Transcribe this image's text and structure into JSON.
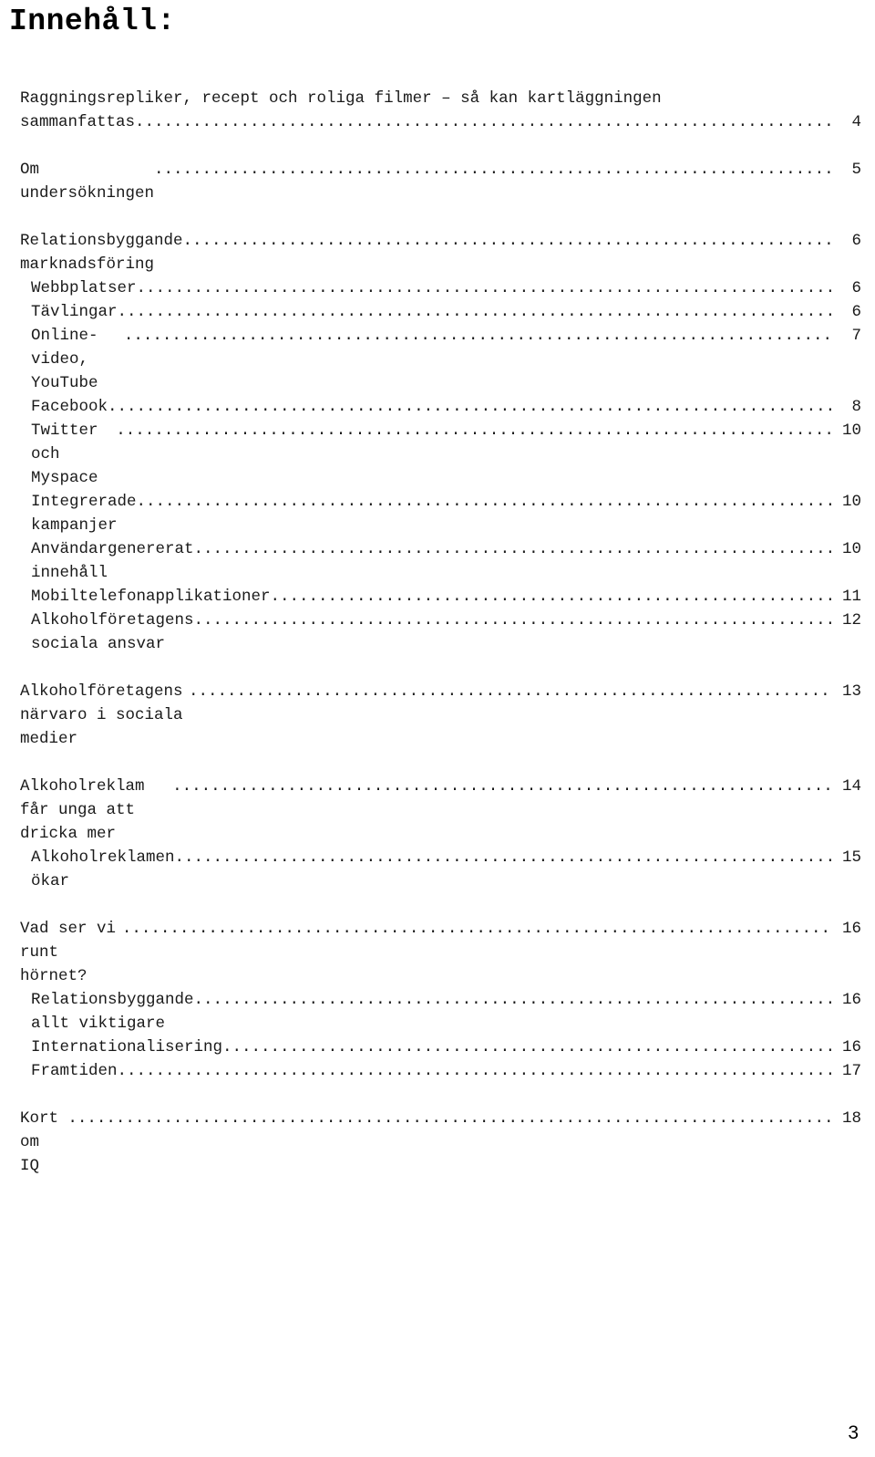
{
  "document": {
    "title": "Innehåll:",
    "footer_page_number": "3",
    "leader_char": "."
  },
  "toc": {
    "entries": [
      {
        "label": "Raggningsrepliker, recept och roliga filmer – så kan kartläggningen sammanfattas",
        "first_line": "Raggningsrepliker, recept och roliga filmer – så kan kartläggningen",
        "last_line": "sammanfattas",
        "page": "4",
        "level": 1,
        "wrapped": true,
        "gap_before": false
      },
      {
        "label": "Om undersökningen",
        "page": "5",
        "level": 1,
        "wrapped": false,
        "gap_before": true
      },
      {
        "label": "Relationsbyggande marknadsföring",
        "page": "6",
        "level": 1,
        "wrapped": false,
        "gap_before": true
      },
      {
        "label": "Webbplatser",
        "page": "6",
        "level": 2,
        "wrapped": false,
        "gap_before": false
      },
      {
        "label": "Tävlingar",
        "page": "6",
        "level": 2,
        "wrapped": false,
        "gap_before": false
      },
      {
        "label": "Online-video, YouTube",
        "page": "7",
        "level": 2,
        "wrapped": false,
        "gap_before": false
      },
      {
        "label": "Facebook",
        "page": "8",
        "level": 2,
        "wrapped": false,
        "gap_before": false
      },
      {
        "label": "Twitter och Myspace",
        "page": "10",
        "level": 2,
        "wrapped": false,
        "gap_before": false
      },
      {
        "label": "Integrerade kampanjer",
        "page": "10",
        "level": 2,
        "wrapped": false,
        "gap_before": false
      },
      {
        "label": "Användargenererat innehåll",
        "page": "10",
        "level": 2,
        "wrapped": false,
        "gap_before": false
      },
      {
        "label": "Mobiltelefonapplikationer",
        "page": "11",
        "level": 2,
        "wrapped": false,
        "gap_before": false
      },
      {
        "label": "Alkoholföretagens sociala ansvar",
        "page": "12",
        "level": 2,
        "wrapped": false,
        "gap_before": false
      },
      {
        "label": "Alkoholföretagens närvaro i sociala medier",
        "page": "13",
        "level": 1,
        "wrapped": false,
        "gap_before": true
      },
      {
        "label": "Alkoholreklam får unga att dricka mer",
        "page": "14",
        "level": 1,
        "wrapped": false,
        "gap_before": true
      },
      {
        "label": "Alkoholreklamen ökar",
        "page": "15",
        "level": 2,
        "wrapped": false,
        "gap_before": false
      },
      {
        "label": "Vad ser vi runt hörnet?",
        "page": "16",
        "level": 1,
        "wrapped": false,
        "gap_before": true
      },
      {
        "label": "Relationsbyggande allt viktigare",
        "page": "16",
        "level": 2,
        "wrapped": false,
        "gap_before": false
      },
      {
        "label": "Internationalisering",
        "page": "16",
        "level": 2,
        "wrapped": false,
        "gap_before": false
      },
      {
        "label": "Framtiden",
        "page": "17",
        "level": 2,
        "wrapped": false,
        "gap_before": false
      },
      {
        "label": "Kort om IQ",
        "page": "18",
        "level": 1,
        "wrapped": false,
        "gap_before": true
      }
    ]
  }
}
